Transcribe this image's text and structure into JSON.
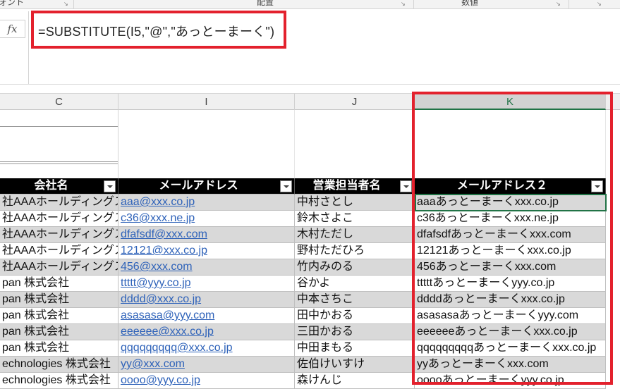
{
  "ribbon": {
    "groups": [
      {
        "label": "フォント"
      },
      {
        "label": "配置"
      },
      {
        "label": "数値"
      }
    ]
  },
  "formula_bar": {
    "fx_label": "fx",
    "formula": "=SUBSTITUTE(I5,\"@\",\"あっとーまーく\")"
  },
  "columns": [
    "C",
    "I",
    "J",
    "K"
  ],
  "selected_column": "K",
  "table": {
    "headers": [
      "会社名",
      "メールアドレス",
      "営業担当者名",
      "メールアドレス２"
    ],
    "rows": [
      {
        "company": "社AAAホールディングス",
        "email": "aaa@xxx.co.jp",
        "rep": "中村さとし",
        "email2": "aaaあっとーまーくxxx.co.jp"
      },
      {
        "company": "社AAAホールディングス",
        "email": "c36@xxx.ne.jp",
        "rep": "鈴木さよこ",
        "email2": "c36あっとーまーくxxx.ne.jp"
      },
      {
        "company": "社AAAホールディングス",
        "email": "dfafsdf@xxx.com",
        "rep": "木村ただし",
        "email2": "dfafsdfあっとーまーくxxx.com"
      },
      {
        "company": "社AAAホールディングス",
        "email": "12121@xxx.co.jp",
        "rep": "野村ただひろ",
        "email2": "12121あっとーまーくxxx.co.jp"
      },
      {
        "company": "社AAAホールディングス",
        "email": "456@xxx.com",
        "rep": "竹内みのる",
        "email2": "456あっとーまーくxxx.com"
      },
      {
        "company": "pan 株式会社",
        "email": "ttttt@yyy.co.jp",
        "rep": "谷かよ",
        "email2": "tttttあっとーまーくyyy.co.jp"
      },
      {
        "company": "pan 株式会社",
        "email": "dddd@xxx.co.jp",
        "rep": "中本さちこ",
        "email2": "ddddあっとーまーくxxx.co.jp"
      },
      {
        "company": "pan 株式会社",
        "email": "asasasa@yyy.com",
        "rep": "田中かおる",
        "email2": "asasasaあっとーまーくyyy.com"
      },
      {
        "company": "pan 株式会社",
        "email": "eeeeee@xxx.co.jp",
        "rep": "三田かおる",
        "email2": "eeeeeeあっとーまーくxxx.co.jp"
      },
      {
        "company": "pan 株式会社",
        "email": "qqqqqqqqq@xxx.co.jp",
        "rep": "中田まもる",
        "email2": "qqqqqqqqqあっとーまーくxxx.co.jp"
      },
      {
        "company": "echnologies 株式会社",
        "email": "yy@xxx.com",
        "rep": "佐伯けいすけ",
        "email2": "yyあっとーまーくxxx.com"
      },
      {
        "company": "echnologies 株式会社",
        "email": "oooo@yyy.co.jp",
        "rep": "森けんじ",
        "email2": "ooooあっとーまーくyyy.co.jp"
      }
    ]
  },
  "colors": {
    "highlight_red": "#e3212d",
    "excel_green": "#217346",
    "link_blue": "#2e62b9",
    "row_shade": "#d9d9d9"
  }
}
